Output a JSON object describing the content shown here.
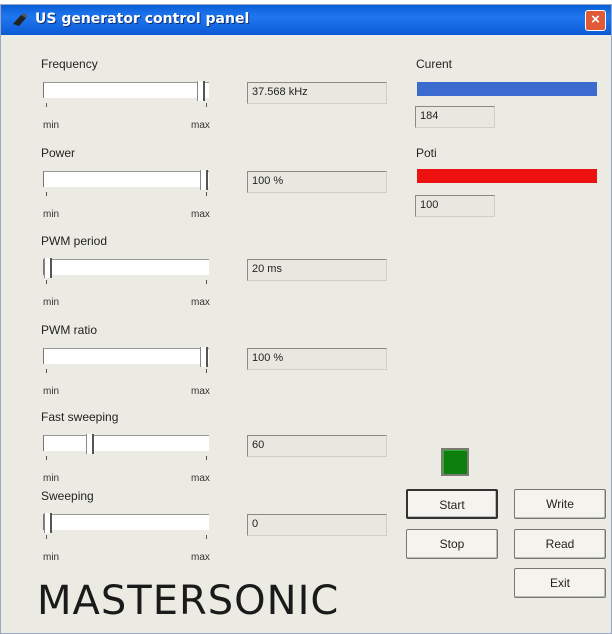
{
  "window": {
    "title": "US generator control panel",
    "close_label": "×"
  },
  "sliders": [
    {
      "label": "Frequency",
      "value_text": "37.568 kHz",
      "position": 0.98
    },
    {
      "label": "Power",
      "value_text": "100 %",
      "position": 1.0
    },
    {
      "label": "PWM period",
      "value_text": "20 ms",
      "position": 0.0
    },
    {
      "label": "PWM ratio",
      "value_text": "100 %",
      "position": 1.0
    },
    {
      "label": "Fast sweeping",
      "value_text": "60",
      "position": 0.27
    },
    {
      "label": "Sweeping",
      "value_text": "0",
      "position": 0.0
    }
  ],
  "slider_ticks": {
    "min": "min",
    "max": "max"
  },
  "meters": {
    "current": {
      "label": "Curent",
      "value": "184",
      "color": "#3c6bd0"
    },
    "poti": {
      "label": "Poti",
      "value": "100",
      "color": "#ee1111"
    }
  },
  "indicator": {
    "color": "#0c7f0c"
  },
  "buttons": {
    "start": "Start",
    "stop": "Stop",
    "write": "Write",
    "read": "Read",
    "exit": "Exit"
  },
  "logo": {
    "text": "MASTERSONIC"
  }
}
